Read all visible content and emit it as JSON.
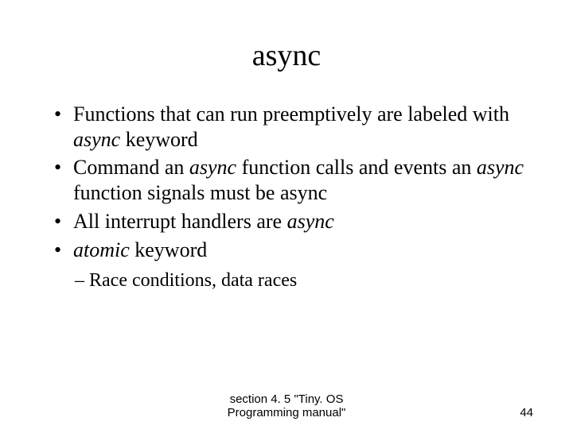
{
  "title": "async",
  "bullets": [
    {
      "segments": [
        {
          "text": "Functions that can run preemptively are labeled with ",
          "italic": false
        },
        {
          "text": "async",
          "italic": true
        },
        {
          "text": " keyword",
          "italic": false
        }
      ]
    },
    {
      "segments": [
        {
          "text": "Command an ",
          "italic": false
        },
        {
          "text": "async",
          "italic": true
        },
        {
          "text": " function calls and events an ",
          "italic": false
        },
        {
          "text": "async",
          "italic": true
        },
        {
          "text": " function signals must be async",
          "italic": false
        }
      ]
    },
    {
      "segments": [
        {
          "text": "All interrupt handlers are ",
          "italic": false
        },
        {
          "text": "async",
          "italic": true
        }
      ]
    },
    {
      "segments": [
        {
          "text": "atomic",
          "italic": true
        },
        {
          "text": " keyword",
          "italic": false
        }
      ]
    }
  ],
  "subbullets": [
    "Race conditions, data races"
  ],
  "footer": {
    "center": "section 4. 5 \"Tiny. OS Programming manual\"",
    "page": "44"
  }
}
